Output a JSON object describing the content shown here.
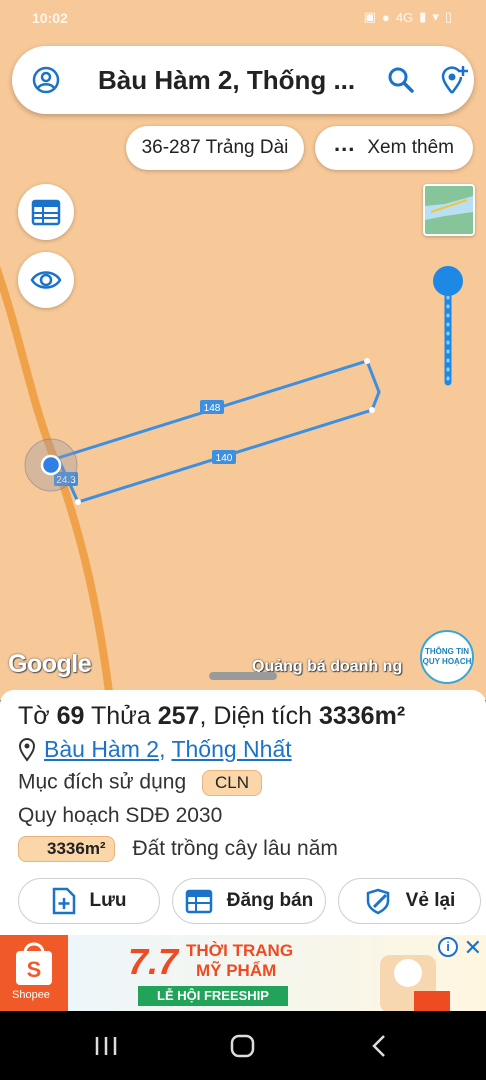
{
  "status_bar": {
    "time": "10:02",
    "icons": [
      "image-icon",
      "location-icon",
      "signal-4g-icon",
      "signal-icon",
      "wifi-icon",
      "battery-icon"
    ],
    "network": "4G"
  },
  "search": {
    "value": "Bàu Hàm 2, Thống ..."
  },
  "chips": {
    "address": "36-287 Trảng Dài",
    "more": "Xem thêm"
  },
  "map": {
    "parcel_label_top": "148",
    "parcel_label_bottom": "140",
    "parcel_label_left": "24.3",
    "google": "Google",
    "promo": "Quảng bá doanh ng",
    "info_badge_line1": "THÔNG TIN",
    "info_badge_line2": "QUY HOẠCH",
    "colors": {
      "land": "#f8c998",
      "road": "#f2a544",
      "parcel": "#3d8fe0"
    }
  },
  "parcel": {
    "sheet_label": "Tờ",
    "sheet_no": "69",
    "lot_label": "Thửa",
    "lot_no": "257",
    "area_label": "Diện tích",
    "area_value": "3336m²",
    "location_a": "Bàu Hàm 2",
    "location_sep": ",",
    "location_b": "Thống Nhất",
    "purpose_label": "Mục đích sử dụng",
    "purpose_code": "CLN",
    "plan_label": "Quy hoạch SDĐ 2030",
    "plan_area": "3336m²",
    "plan_desc": "Đất trồng cây lâu năm"
  },
  "actions": {
    "save": "Lưu",
    "sell": "Đăng bán",
    "redraw": "Vẻ lại"
  },
  "ad": {
    "brand": "Shopee",
    "big": "7.7",
    "line1": "THỜI TRANG",
    "line2": "MỸ PHẨM",
    "banner": "LỄ HỘI FREESHIP"
  }
}
